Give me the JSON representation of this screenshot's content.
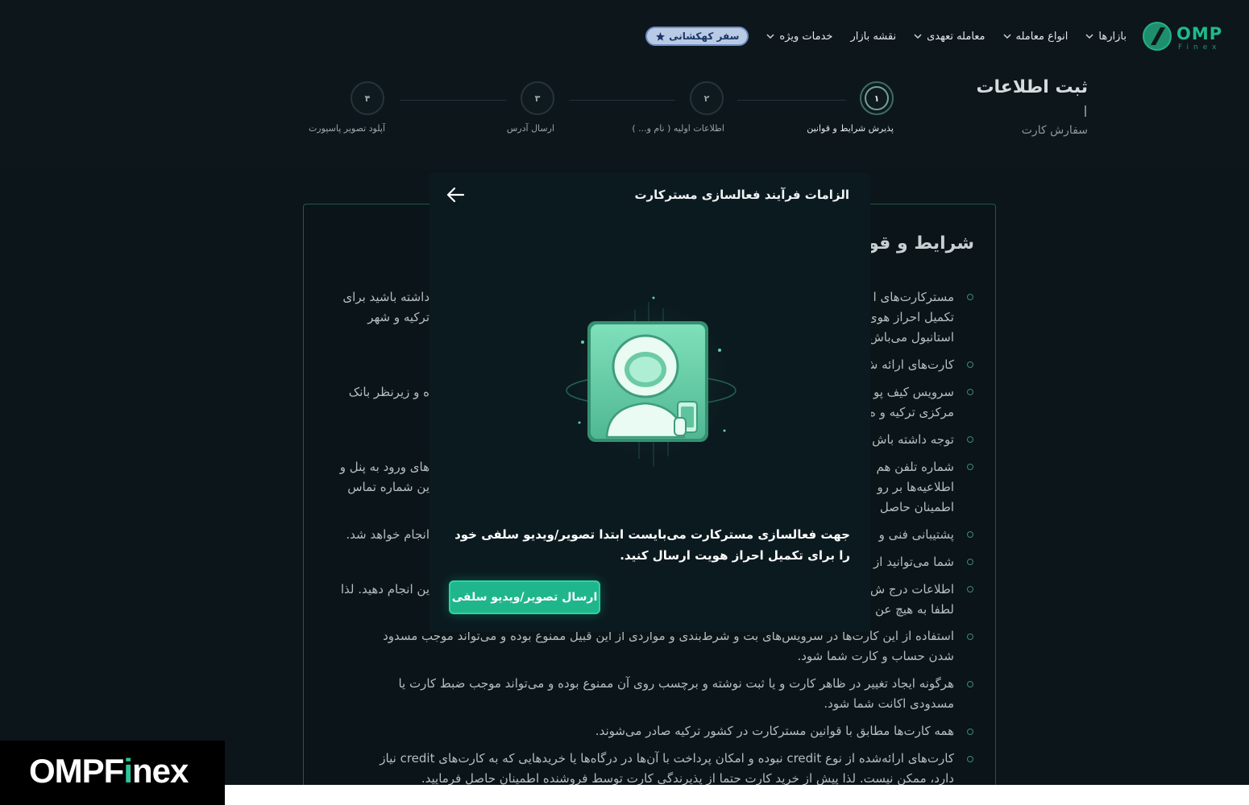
{
  "nav": {
    "logo_text": "OMP",
    "logo_sub": "Finex",
    "items": [
      {
        "label": "بازارها",
        "has_dropdown": true
      },
      {
        "label": "انواع معامله",
        "has_dropdown": true
      },
      {
        "label": "معامله تعهدی",
        "has_dropdown": true
      },
      {
        "label": "نقشه بازار",
        "has_dropdown": false
      },
      {
        "label": "خدمات ویژه",
        "has_dropdown": true
      }
    ],
    "pill_label": "سفر کهکشانی"
  },
  "header": {
    "title": "ثبت اطلاعات",
    "subtitle": "سفارش کارت"
  },
  "stepper": {
    "steps": [
      {
        "number": "۱",
        "label": "پذیرش شرایط و قوانین"
      },
      {
        "number": "۲",
        "label": "اطلاعات اولیه ( نام و... )"
      },
      {
        "number": "۳",
        "label": "ارسال آدرس"
      },
      {
        "number": "۴",
        "label": "آپلود تصویر پاسپورت"
      }
    ]
  },
  "terms": {
    "heading": "شرایط و قوانین",
    "right_fragments": [
      "مسترکارت‌های ا",
      "تکمیل احراز هوی",
      "استانبول می‌باش",
      "کارت‌های ارائه ش",
      "سرویس کیف پو",
      "مرکزی ترکیه و ه",
      "توجه داشته باش",
      "شماره تلفن هم",
      "اطلاعیه‌ها بر رو",
      "اطمینان حاصل",
      "پشتیبانی فنی و",
      "شما می‌توانید از",
      "اطلاعات درج ش",
      "لطفا به هیچ عن"
    ],
    "left_fragments": [
      "داشته باشید برای",
      "ترکیه و شهر",
      "ه و زیرنظر بانک",
      "های ورود به پنل و",
      "ین شماره تماس",
      "انجام خواهد شد.",
      "ین انجام دهید. لذا"
    ],
    "full_items": [
      {
        "line1": "استفاده از این کارت‌ها در سرویس‌های بت و شرط‌بندی و مواردی از این قبیل ممنوع بوده و می‌تواند موجب مسدود",
        "line2": "شدن حساب و کارت شما شود."
      },
      {
        "line1": "هرگونه ایجاد تغییر در ظاهر کارت و یا ثبت نوشته و برچسب روی آن ممنوع بوده و می‌تواند موجب ضبط کارت یا",
        "line2": "مسدودی اکانت شما شود."
      },
      {
        "line1": "همه کارت‌ها مطابق با قوانین مسترکارت در کشور ترکیه صادر می‌شوند.",
        "line2": ""
      },
      {
        "line1": "کارت‌های ارائه‌شده از نوع credit نبوده و امکان پرداخت با آن‌ها در درگاه‌ها یا خریدهایی که به کارت‌های credit نیاز",
        "line2": "دارد، ممکن نیست. لذا پیش از خرید کارت حتما از پذیرندگی کارت توسط فروشنده اطمینان حاصل فرمایید."
      }
    ]
  },
  "modal": {
    "title": "الزامات فرآیند فعالسازی مسترکارت",
    "message": "جهت فعالسازی مسترکارت می‌بایست ابتدا تصویر/ویدیو سلفی خود را برای تکمیل احراز هویت ارسال کنید.",
    "button_label": "ارسال تصویر/ویدیو سلفی"
  },
  "watermark": {
    "part1": "OMPF",
    "part2": "i",
    "part3": "nex"
  },
  "colors": {
    "accent": "#20b68c",
    "background": "#0c1519",
    "modal_bg": "#0b1a1f"
  }
}
